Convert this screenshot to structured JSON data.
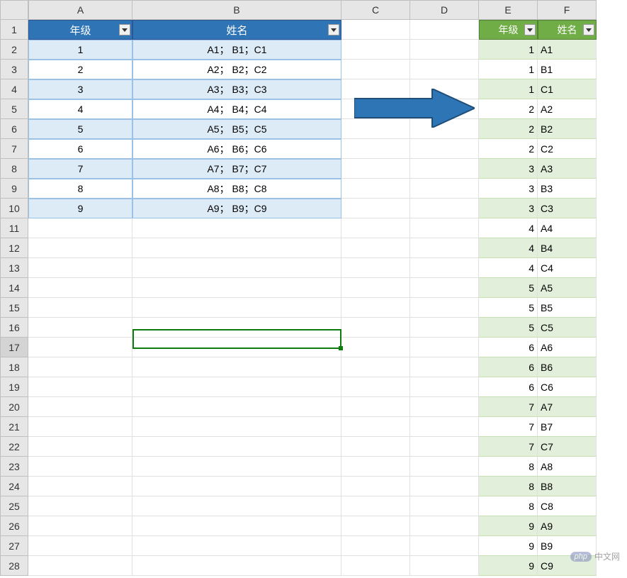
{
  "columns": [
    "A",
    "B",
    "C",
    "D",
    "E",
    "F"
  ],
  "row_count": 28,
  "blue_table": {
    "headers": [
      "年级",
      "姓名"
    ],
    "rows": [
      [
        "1",
        "A1； B1；C1"
      ],
      [
        "2",
        "A2； B2；C2"
      ],
      [
        "3",
        "A3； B3；C3"
      ],
      [
        "4",
        "A4； B4；C4"
      ],
      [
        "5",
        "A5； B5；C5"
      ],
      [
        "6",
        "A6； B6；C6"
      ],
      [
        "7",
        "A7； B7；C7"
      ],
      [
        "8",
        "A8； B8；C8"
      ],
      [
        "9",
        "A9； B9；C9"
      ]
    ]
  },
  "green_table": {
    "headers": [
      "年级",
      "姓名"
    ],
    "rows": [
      [
        "1",
        "A1"
      ],
      [
        "1",
        "B1"
      ],
      [
        "1",
        "C1"
      ],
      [
        "2",
        "A2"
      ],
      [
        "2",
        "B2"
      ],
      [
        "2",
        "C2"
      ],
      [
        "3",
        "A3"
      ],
      [
        "3",
        "B3"
      ],
      [
        "3",
        "C3"
      ],
      [
        "4",
        "A4"
      ],
      [
        "4",
        "B4"
      ],
      [
        "4",
        "C4"
      ],
      [
        "5",
        "A5"
      ],
      [
        "5",
        "B5"
      ],
      [
        "5",
        "C5"
      ],
      [
        "6",
        "A6"
      ],
      [
        "6",
        "B6"
      ],
      [
        "6",
        "C6"
      ],
      [
        "7",
        "A7"
      ],
      [
        "7",
        "B7"
      ],
      [
        "7",
        "C7"
      ],
      [
        "8",
        "A8"
      ],
      [
        "8",
        "B8"
      ],
      [
        "8",
        "C8"
      ],
      [
        "9",
        "A9"
      ],
      [
        "9",
        "B9"
      ],
      [
        "9",
        "C9"
      ]
    ]
  },
  "active_cell": "B17",
  "active_row": 17,
  "arrow_color_fill": "#2e75b6",
  "arrow_color_stroke": "#1f4e79",
  "watermark_text": "中文网",
  "watermark_badge": "php"
}
